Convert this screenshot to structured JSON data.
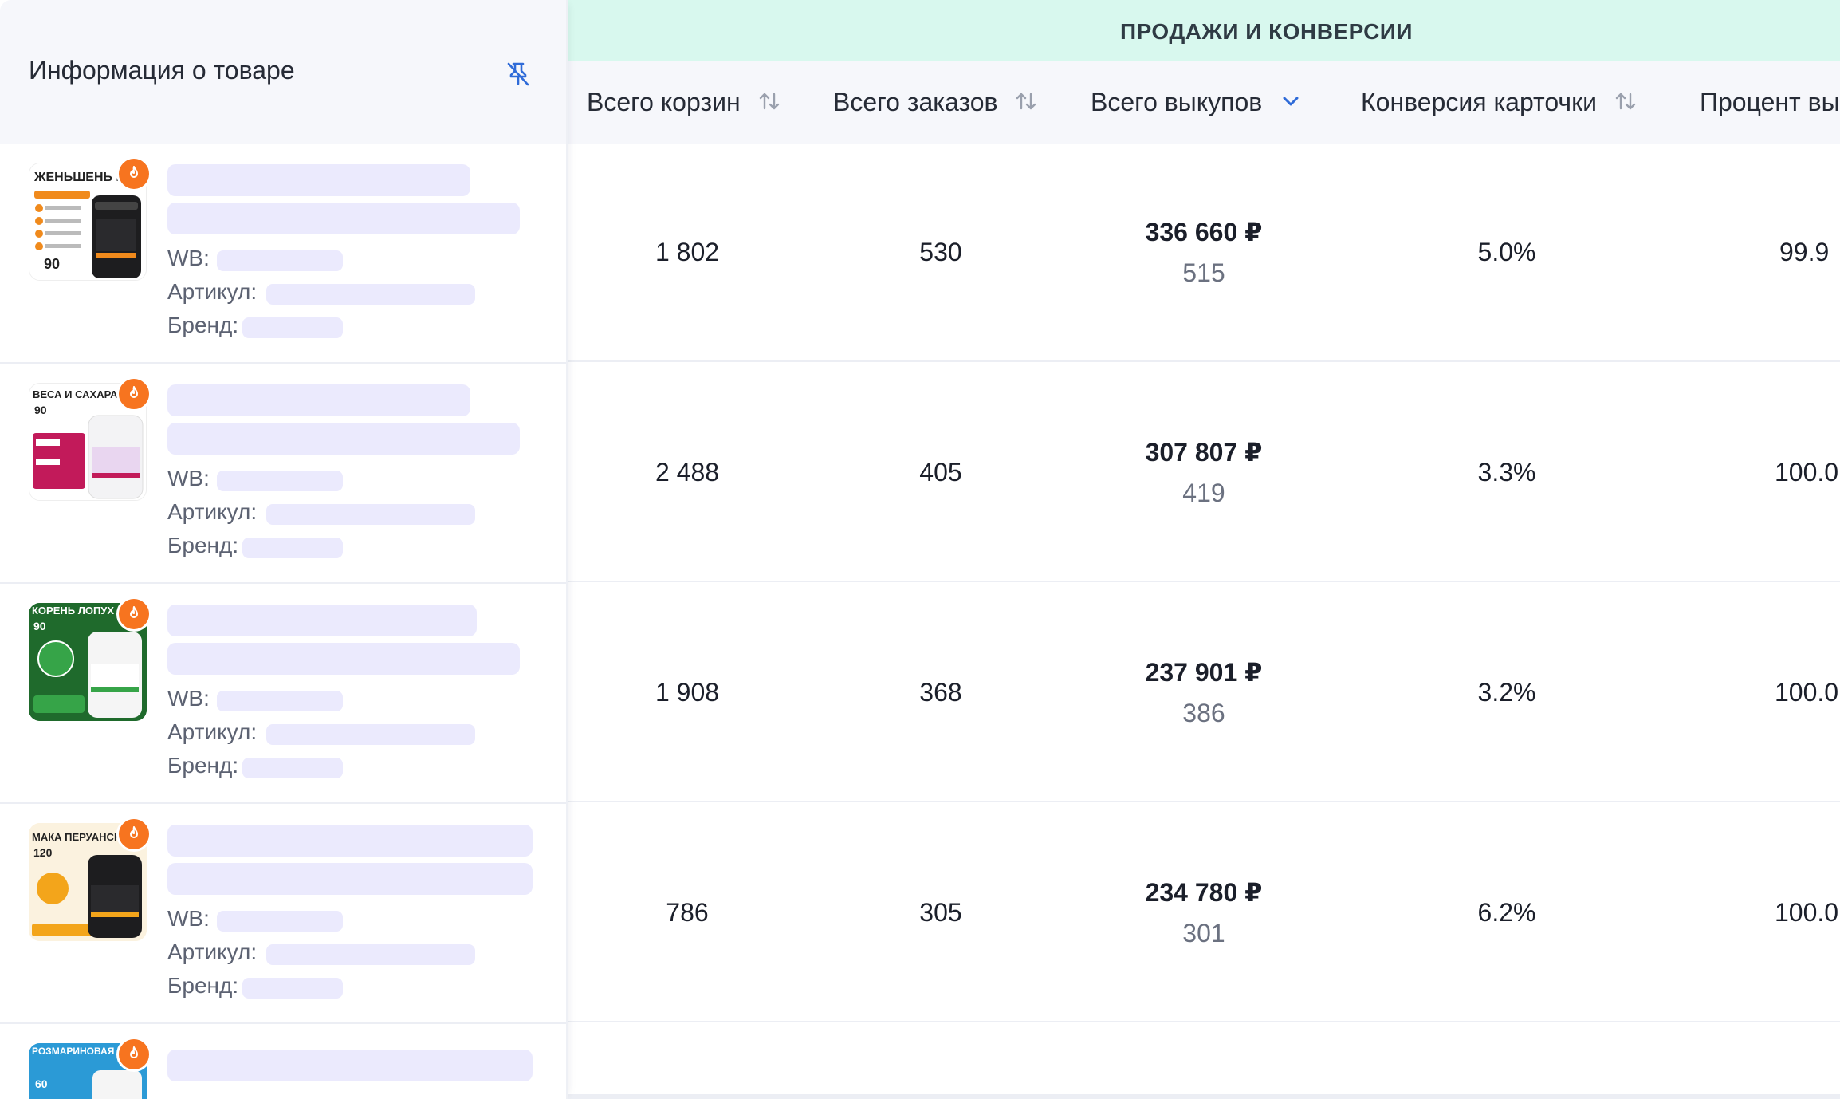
{
  "left_header": {
    "title": "Информация о товаре",
    "unpin_icon": "unpin-icon"
  },
  "group_header": {
    "title": "ПРОДАЖИ И КОНВЕРСИИ"
  },
  "columns": [
    {
      "label": "Всего корзин",
      "sort": "sort-both-icon"
    },
    {
      "label": "Всего заказов",
      "sort": "sort-both-icon"
    },
    {
      "label": "Всего выкупов",
      "sort": "chevron-down-icon",
      "accent": "#2f6bd8"
    },
    {
      "label": "Конверсия карточки",
      "sort": "sort-both-icon"
    },
    {
      "label": "Процент вы",
      "sort": ""
    }
  ],
  "meta_labels": {
    "wb": "WB:",
    "article": "Артикул:",
    "brand": "Бренд:"
  },
  "products": [
    {
      "thumb_title": "ЖЕНЬШЕНЬ ЙОХИМБЕ",
      "thumb_sub": "90",
      "thumb_bg": "#ffffff",
      "thumb_accent": "#f08a1c",
      "carts": "1 802",
      "orders": "530",
      "buyouts_sum": "336 660 ₽",
      "buyouts_count": "515",
      "conversion": "5.0%",
      "percent": "99.9"
    },
    {
      "thumb_title": "ВЕСА И САХАРА",
      "thumb_sub": "90",
      "thumb_bg": "#ffffff",
      "thumb_accent": "#c21a5a",
      "carts": "2 488",
      "orders": "405",
      "buyouts_sum": "307 807 ₽",
      "buyouts_count": "419",
      "conversion": "3.3%",
      "percent": "100.0"
    },
    {
      "thumb_title": "КОРЕНЬ ЛОПУХ",
      "thumb_sub": "90",
      "thumb_bg": "#1f6a2c",
      "thumb_accent": "#36a448",
      "carts": "1 908",
      "orders": "368",
      "buyouts_sum": "237 901 ₽",
      "buyouts_count": "386",
      "conversion": "3.2%",
      "percent": "100.0"
    },
    {
      "thumb_title": "МАКА ПЕРУАНСКАЯ",
      "thumb_sub": "120",
      "thumb_bg": "#fbf2df",
      "thumb_accent": "#f3a51b",
      "carts": "786",
      "orders": "305",
      "buyouts_sum": "234 780 ₽",
      "buyouts_count": "301",
      "conversion": "6.2%",
      "percent": "100.0"
    },
    {
      "thumb_title": "РОЗМАРИНОВАЯ КИСЛОТА",
      "thumb_sub": "60",
      "thumb_bg": "#2b9ad6",
      "thumb_accent": "#1c6fb8",
      "carts": "",
      "orders": "",
      "buyouts_sum": "",
      "buyouts_count": "",
      "conversion": "",
      "percent": ""
    }
  ]
}
